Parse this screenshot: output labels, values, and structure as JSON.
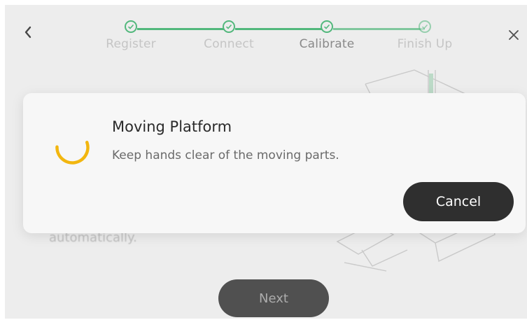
{
  "header": {
    "back_icon": "chevron-left-icon",
    "close_icon": "close-icon"
  },
  "stepper": {
    "steps": [
      {
        "label": "Register",
        "completed": true
      },
      {
        "label": "Connect",
        "completed": true
      },
      {
        "label": "Calibrate",
        "completed": true,
        "current": true
      },
      {
        "label": "Finish Up",
        "completed": true
      }
    ],
    "color": "#3cb46e"
  },
  "background": {
    "hint_text": "automatically."
  },
  "footer": {
    "next_label": "Next"
  },
  "dialog": {
    "title": "Moving Platform",
    "message": "Keep hands clear of the moving parts.",
    "cancel_label": "Cancel",
    "spinner_color": "#f2b60f"
  }
}
